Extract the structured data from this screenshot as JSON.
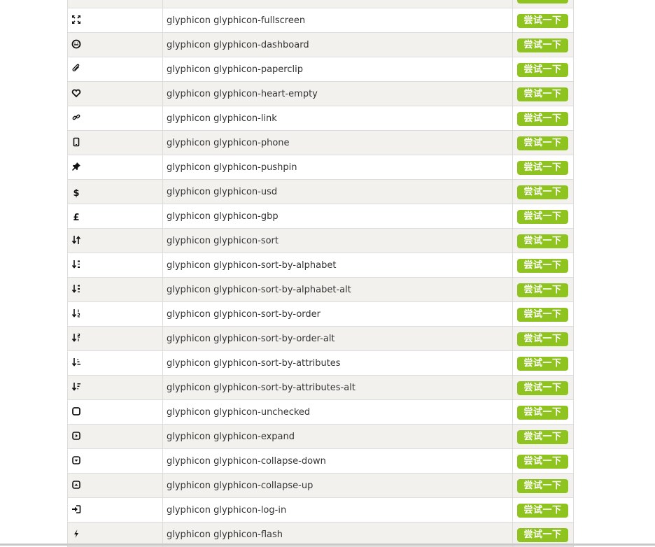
{
  "button_label": "尝试一下",
  "accent_color": "#8fc31f",
  "rows": [
    {
      "icon": "fullscreen-icon",
      "class_name": ""
    },
    {
      "icon": "fullscreen-icon",
      "class_name": "glyphicon glyphicon-fullscreen"
    },
    {
      "icon": "dashboard-icon",
      "class_name": "glyphicon glyphicon-dashboard"
    },
    {
      "icon": "paperclip-icon",
      "class_name": "glyphicon glyphicon-paperclip"
    },
    {
      "icon": "heart-empty-icon",
      "class_name": "glyphicon glyphicon-heart-empty"
    },
    {
      "icon": "link-icon",
      "class_name": "glyphicon glyphicon-link"
    },
    {
      "icon": "phone-icon",
      "class_name": "glyphicon glyphicon-phone"
    },
    {
      "icon": "pushpin-icon",
      "class_name": "glyphicon glyphicon-pushpin"
    },
    {
      "icon": "usd-icon",
      "class_name": "glyphicon glyphicon-usd"
    },
    {
      "icon": "gbp-icon",
      "class_name": "glyphicon glyphicon-gbp"
    },
    {
      "icon": "sort-icon",
      "class_name": "glyphicon glyphicon-sort"
    },
    {
      "icon": "sort-by-alphabet-icon",
      "class_name": "glyphicon glyphicon-sort-by-alphabet"
    },
    {
      "icon": "sort-by-alphabet-alt-icon",
      "class_name": "glyphicon glyphicon-sort-by-alphabet-alt"
    },
    {
      "icon": "sort-by-order-icon",
      "class_name": "glyphicon glyphicon-sort-by-order"
    },
    {
      "icon": "sort-by-order-alt-icon",
      "class_name": "glyphicon glyphicon-sort-by-order-alt"
    },
    {
      "icon": "sort-by-attributes-icon",
      "class_name": "glyphicon glyphicon-sort-by-attributes"
    },
    {
      "icon": "sort-by-attributes-alt-icon",
      "class_name": "glyphicon glyphicon-sort-by-attributes-alt"
    },
    {
      "icon": "unchecked-icon",
      "class_name": "glyphicon glyphicon-unchecked"
    },
    {
      "icon": "expand-icon",
      "class_name": "glyphicon glyphicon-expand"
    },
    {
      "icon": "collapse-down-icon",
      "class_name": "glyphicon glyphicon-collapse-down"
    },
    {
      "icon": "collapse-up-icon",
      "class_name": "glyphicon glyphicon-collapse-up"
    },
    {
      "icon": "log-in-icon",
      "class_name": "glyphicon glyphicon-log-in"
    },
    {
      "icon": "flash-icon",
      "class_name": "glyphicon glyphicon-flash"
    }
  ]
}
